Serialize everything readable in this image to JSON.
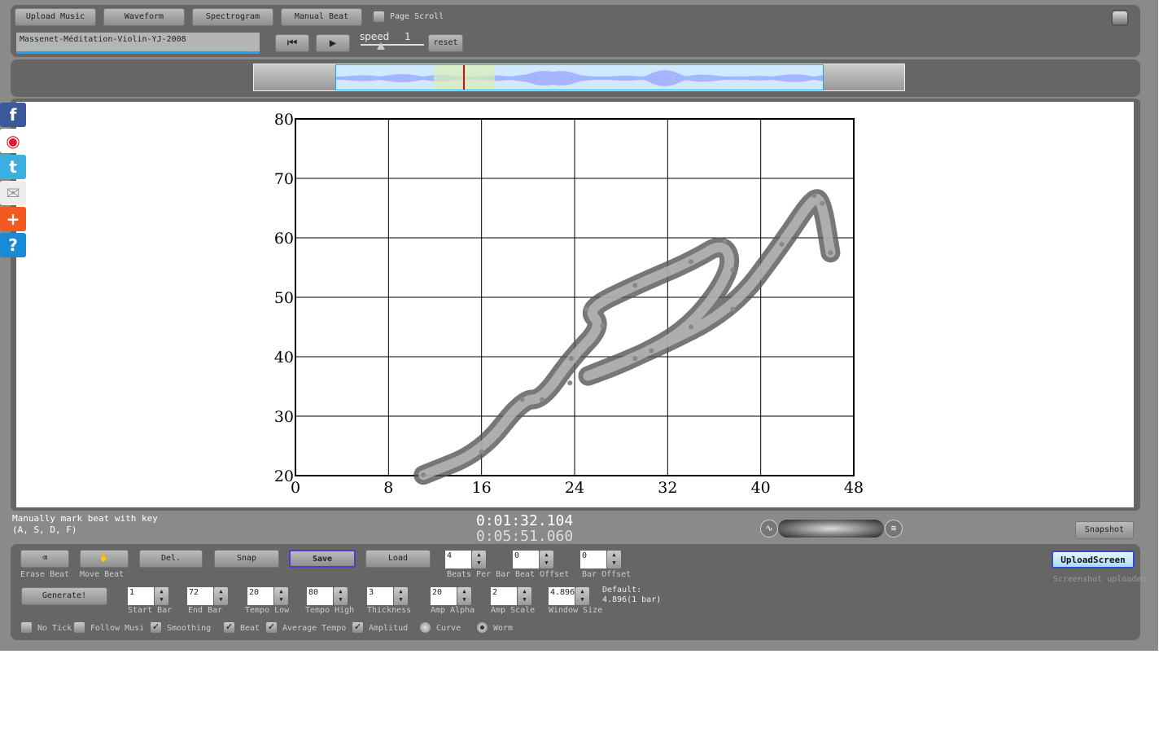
{
  "toolbar": {
    "upload": "Upload Music",
    "waveform": "Waveform",
    "spectrogram": "Spectrogram",
    "manual_beat": "Manual Beat",
    "page_scroll": "Page Scroll",
    "file_name": "Massenet-Méditation-Violin-YJ-2008",
    "speed_label": "speed",
    "speed_value": "1",
    "reset": "reset"
  },
  "social": [
    "facebook-icon",
    "weibo-icon",
    "twitter-icon",
    "email-icon",
    "add-icon",
    "help-icon"
  ],
  "status": {
    "hint1": "Manually mark beat with key",
    "hint2": "(A, S, D, F)",
    "current_time": "0:01:32.104",
    "total_time": "0:05:51.060",
    "snapshot": "Snapshot",
    "upload_screen": "UploadScreen",
    "upload_status": "Screenshot uploaded"
  },
  "controls": {
    "erase": "Erase Beat",
    "move": "Move Beat",
    "del": "Del.",
    "snap": "Snap",
    "save": "Save",
    "load": "Load",
    "generate": "Generate!",
    "beats_per_bar": {
      "label": "Beats Per Bar",
      "value": "4"
    },
    "beat_offset": {
      "label": "Beat Offset",
      "value": "0"
    },
    "bar_offset": {
      "label": "Bar Offset",
      "value": "0"
    },
    "start_bar": {
      "label": "Start Bar",
      "value": "1"
    },
    "end_bar": {
      "label": "End Bar",
      "value": "72"
    },
    "tempo_low": {
      "label": "Tempo Low",
      "value": "20"
    },
    "tempo_high": {
      "label": "Tempo High",
      "value": "80"
    },
    "thickness": {
      "label": "Thickness",
      "value": "3"
    },
    "amp_alpha": {
      "label": "Amp Alpha",
      "value": "20"
    },
    "amp_scale": {
      "label": "Amp Scale",
      "value": "2"
    },
    "window_size": {
      "label": "Window Size",
      "value": "4.896"
    },
    "default1": "Default:",
    "default2": "4.896(1 bar)",
    "checks": [
      {
        "label": "No Tick",
        "checked": false
      },
      {
        "label": "Follow Musi",
        "checked": false
      },
      {
        "label": "Smoothing",
        "checked": true
      },
      {
        "label": "Beat",
        "checked": true
      },
      {
        "label": "Average Tempo",
        "checked": true
      },
      {
        "label": "Amplitud",
        "checked": true
      }
    ],
    "radios": [
      {
        "label": "Curve",
        "selected": false
      },
      {
        "label": "Worm",
        "selected": true
      }
    ]
  },
  "chart_data": {
    "type": "line",
    "xlim": [
      0,
      48
    ],
    "ylim": [
      20,
      80
    ],
    "xticks": [
      "0",
      "8",
      "16",
      "24",
      "32",
      "40",
      "48"
    ],
    "yticks": [
      "20",
      "30",
      "40",
      "50",
      "60",
      "70",
      "80"
    ],
    "grid": true,
    "series": [
      {
        "x": [
          11,
          16,
          19.5,
          21.2,
          23.7,
          26.4,
          25,
          29.2,
          34,
          36.9,
          37.6,
          34,
          29.2,
          23.6,
          30.6,
          37.6,
          41.8,
          44.6,
          45.3,
          46
        ],
        "y": [
          20.1,
          24,
          32.8,
          32.8,
          39.7,
          45.2,
          48,
          52,
          56,
          59.4,
          54.6,
          45,
          39.7,
          35.6,
          41,
          48,
          58.9,
          67.1,
          65.8,
          57.5
        ]
      }
    ]
  }
}
